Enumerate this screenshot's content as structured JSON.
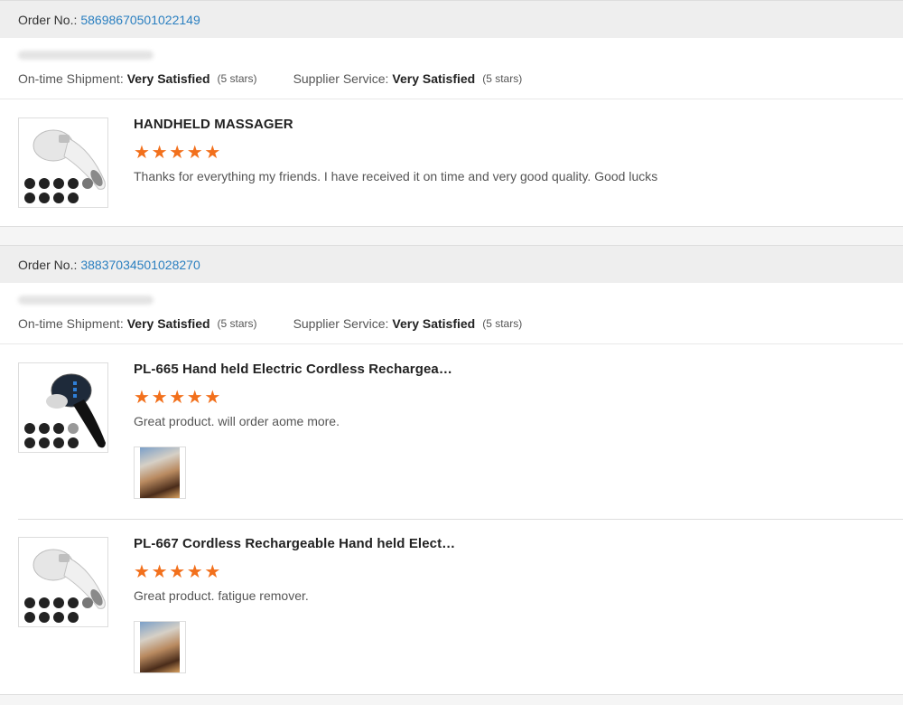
{
  "orders": [
    {
      "order_label": "Order No.:",
      "order_number": "58698670501022149",
      "shipment_label": "On-time Shipment:",
      "shipment_value": "Very Satisfied",
      "shipment_stars": "(5 stars)",
      "service_label": "Supplier Service:",
      "service_value": "Very Satisfied",
      "service_stars": "(5 stars)",
      "items": [
        {
          "title": "HANDHELD MASSAGER",
          "rating": 5,
          "comment": "Thanks for everything my friends. I have received it on time and very good quality. Good lucks",
          "thumb_icon": "white-massager-icon"
        }
      ]
    },
    {
      "order_label": "Order No.:",
      "order_number": "38837034501028270",
      "shipment_label": "On-time Shipment:",
      "shipment_value": "Very Satisfied",
      "shipment_stars": "(5 stars)",
      "service_label": "Supplier Service:",
      "service_value": "Very Satisfied",
      "service_stars": "(5 stars)",
      "items": [
        {
          "title": "PL-665 Hand held Electric Cordless Rechargea…",
          "rating": 5,
          "comment": "Great product. will order aome more.",
          "thumb_icon": "black-massager-icon",
          "has_photo": true
        },
        {
          "title": "PL-667 Cordless Rechargeable Hand held Elect…",
          "rating": 5,
          "comment": "Great product. fatigue remover.",
          "thumb_icon": "white-massager-icon",
          "has_photo": true
        }
      ]
    }
  ],
  "colors": {
    "star": "#f2701c",
    "link": "#2a7fc0",
    "header_bg": "#eeeeee"
  }
}
